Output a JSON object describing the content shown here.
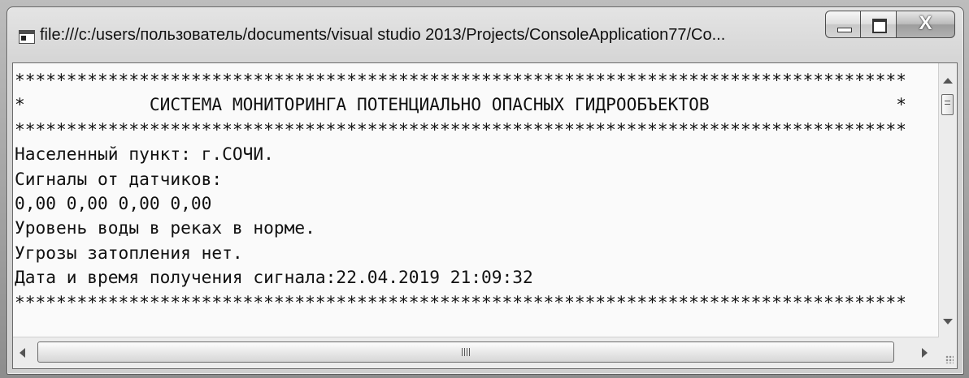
{
  "window": {
    "title": "file:///c:/users/пользователь/documents/visual studio 2013/Projects/ConsoleApplication77/Co..."
  },
  "icons": {
    "app": "console-app-icon",
    "minimize": "minimize-icon",
    "maximize": "maximize-icon",
    "close": "close-icon"
  },
  "controls": {
    "close_label": "X"
  },
  "console": {
    "lines": [
      "**************************************************************************************",
      "*            СИСТЕМА МОНИТОРИНГА ПОТЕНЦИАЛЬНО ОПАСНЫХ ГИДРООБЪЕКТОВ                  *",
      "**************************************************************************************",
      "Населенный пункт: г.СОЧИ.",
      "Сигналы от датчиков:",
      "0,00 0,00 0,00 0,00",
      "Уровень воды в реках в норме.",
      "Угрозы затопления нет.",
      "Дата и время получения сигнала:22.04.2019 21:09:32",
      "**************************************************************************************"
    ]
  },
  "colors": {
    "console_background": "#fafafa",
    "console_text": "#111111"
  }
}
